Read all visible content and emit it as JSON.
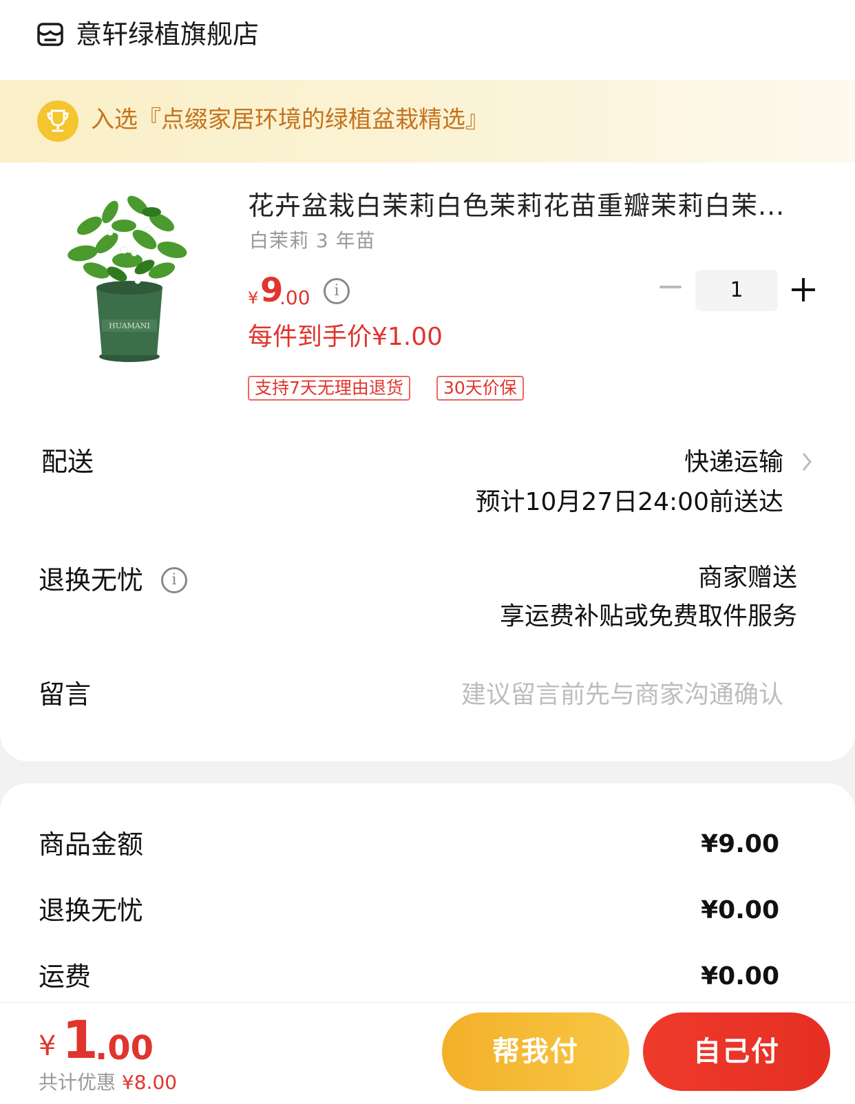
{
  "shop": {
    "name": "意轩绿植旗舰店",
    "icon": "store-icon"
  },
  "banner": {
    "icon": "trophy-icon",
    "text": "入选『点缀家居环境的绿植盆栽精选』",
    "color": "#c4731d"
  },
  "product": {
    "title": "花卉盆栽白茉莉白色茉莉花苗重瓣茉莉白茉...",
    "spec": "白茉莉 3 年苗",
    "price": {
      "symbol": "¥",
      "int": "9",
      "dec": ".00"
    },
    "hand_price": "每件到手价¥1.00",
    "tags": [
      "支持7天无理由退货",
      "30天价保"
    ],
    "quantity": "1",
    "image": "potted-jasmine-plant"
  },
  "delivery": {
    "label": "配送",
    "method": "快递运输",
    "eta": "预计10月27日24:00前送达"
  },
  "returns": {
    "label": "退换无忧",
    "value1": "商家赠送",
    "value2": "享运费补贴或免费取件服务"
  },
  "message": {
    "label": "留言",
    "placeholder": "建议留言前先与商家沟通确认"
  },
  "summary": [
    {
      "label": "商品金额",
      "value": "¥9.00"
    },
    {
      "label": "退换无忧",
      "value": "¥0.00"
    },
    {
      "label": "运费",
      "value": "¥0.00"
    }
  ],
  "footer": {
    "total": {
      "symbol": "¥",
      "int": "1",
      "dec": ".00"
    },
    "saving_label": "共计优惠",
    "saving_value": "¥8.00",
    "help_pay": "帮我付",
    "self_pay": "自己付"
  },
  "colors": {
    "accent_red": "#e0342d",
    "accent_yellow": "#f3b02a",
    "banner_bg": "#faefc7"
  }
}
